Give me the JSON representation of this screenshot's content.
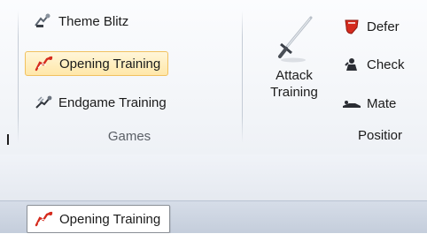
{
  "ribbon": {
    "games": {
      "items": [
        {
          "label": "Theme Blitz",
          "icon": "theme-blitz-icon"
        },
        {
          "label": "Opening Training",
          "icon": "opening-training-icon",
          "selected": true
        },
        {
          "label": "Endgame Training",
          "icon": "endgame-training-icon"
        }
      ],
      "group_label": "Games"
    },
    "positions": {
      "attack_label_line1": "Attack",
      "attack_label_line2": "Training",
      "items": [
        {
          "label": "Defer",
          "icon": "defense-shield-icon"
        },
        {
          "label": "Check",
          "icon": "checkmate-icon"
        },
        {
          "label": "Mate",
          "icon": "mate-icon"
        }
      ],
      "group_label": "Positior"
    }
  },
  "tabbar": {
    "active_tab_label": "Opening Training",
    "active_tab_icon": "opening-training-icon"
  },
  "colors": {
    "selected_bg": "#ffe7a9",
    "selected_border": "#f1c15f",
    "tab_bar": "#c4cddb",
    "icon_red": "#d52b1e"
  }
}
